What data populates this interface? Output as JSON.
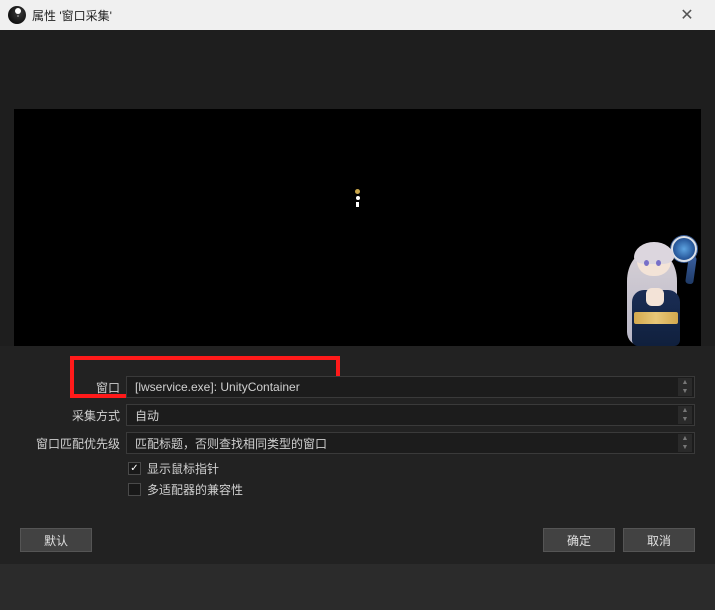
{
  "titlebar": {
    "title": "属性 '窗口采集'"
  },
  "form": {
    "window_label": "窗口",
    "window_value": "[lwservice.exe]: UnityContainer",
    "capture_label": "采集方式",
    "capture_value": "自动",
    "priority_label": "窗口匹配优先级",
    "priority_value": "匹配标题，否则查找相同类型的窗口",
    "show_cursor_label": "显示鼠标指针",
    "compat_label": "多适配器的兼容性"
  },
  "buttons": {
    "defaults": "默认",
    "ok": "确定",
    "cancel": "取消"
  }
}
